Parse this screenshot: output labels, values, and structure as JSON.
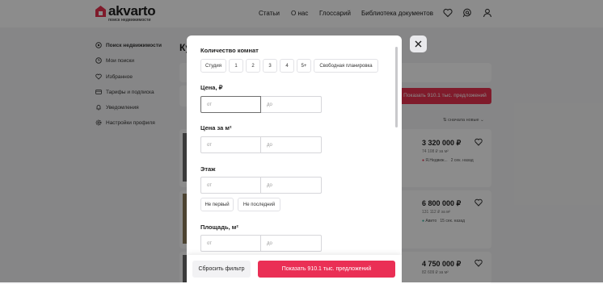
{
  "header": {
    "logo_text": "akvarto",
    "logo_sub": "поиск недвижимости",
    "nav": [
      "Статьи",
      "О нас",
      "Глоссарий",
      "Библиотека документов"
    ],
    "icons": [
      "heart-icon",
      "chat-search-icon",
      "user-icon"
    ]
  },
  "sidebar": {
    "items": [
      {
        "label": "Поиск недвижимости",
        "icon": "search-icon"
      },
      {
        "label": "Мои поиски",
        "icon": "history-icon"
      },
      {
        "label": "Избранное",
        "icon": "heart-icon"
      },
      {
        "label": "Тарифы и подписка",
        "icon": "wallet-icon"
      },
      {
        "label": "Уведомления",
        "icon": "bell-icon"
      },
      {
        "label": "Настройки профиля",
        "icon": "gear-icon"
      }
    ]
  },
  "background": {
    "title_partial": "Ку",
    "show_button": "Показать 910.1 тыс. предложений",
    "sort_label": "сначала новые",
    "listings": [
      {
        "price": "3 320 000 ₽",
        "per_m2": "74 108 ₽ за м²",
        "source": "Я.Недвиж...",
        "time": "2 сек. назад"
      },
      {
        "price": "6 800 000 ₽",
        "per_m2": "131 112 ₽ за м²",
        "source": "Авито",
        "time": "15 сек. назад"
      },
      {
        "price": "4 750 000 ₽",
        "per_m2": "82 609 ₽ за м²",
        "source": "",
        "time": ""
      }
    ]
  },
  "modal": {
    "rooms": {
      "title": "Количество комнат",
      "options": [
        "Студия",
        "1",
        "2",
        "3",
        "4",
        "5+",
        "Свободная планировка"
      ]
    },
    "price": {
      "title": "Цена, ₽",
      "from": "от",
      "to": "до"
    },
    "price_m2": {
      "title": "Цена за м²",
      "from": "от",
      "to": "до"
    },
    "floor": {
      "title": "Этаж",
      "from": "от",
      "to": "до",
      "options": [
        "Не первый",
        "Не последний"
      ]
    },
    "area": {
      "title": "Площадь, м²",
      "from": "от",
      "to": "до"
    },
    "reset_label": "Сбросить фильтр",
    "show_label": "Показать 910.1 тыс. предложений"
  },
  "colors": {
    "accent": "#ea2f55",
    "overlay": "rgba(0,0,0,0.45)"
  }
}
